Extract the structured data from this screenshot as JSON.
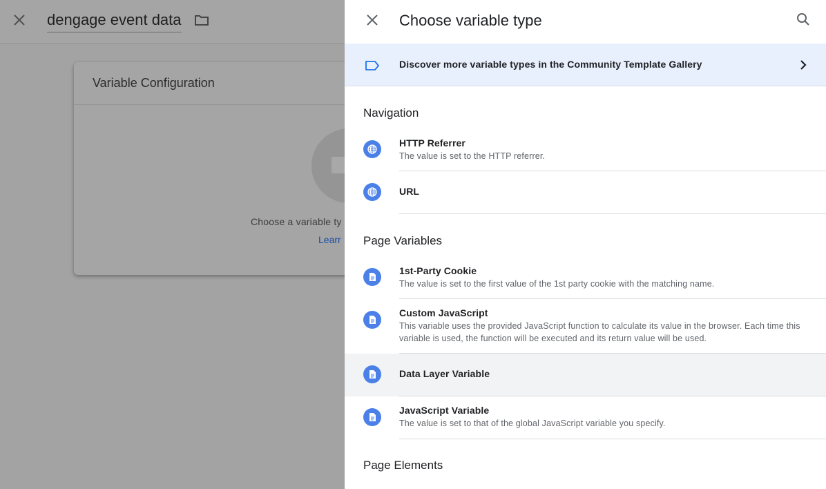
{
  "background": {
    "title": "dengage event data",
    "card": {
      "title": "Variable Configuration",
      "prompt_text": "Choose a variable ty",
      "link_text": "Learr"
    }
  },
  "panel": {
    "title": "Choose variable type",
    "banner_text": "Discover more variable types in the Community Template Gallery",
    "sections": [
      {
        "label": "Navigation",
        "items": [
          {
            "title": "HTTP Referrer",
            "desc": "The value is set to the HTTP referrer.",
            "icon": "globe-icon"
          },
          {
            "title": "URL",
            "desc": "",
            "icon": "globe-icon"
          }
        ]
      },
      {
        "label": "Page Variables",
        "items": [
          {
            "title": "1st-Party Cookie",
            "desc": "The value is set to the first value of the 1st party cookie with the matching name.",
            "icon": "document-icon"
          },
          {
            "title": "Custom JavaScript",
            "desc": "This variable uses the provided JavaScript function to calculate its value in the browser. Each time this variable is used, the function will be executed and its return value will be used.",
            "icon": "document-icon"
          },
          {
            "title": "Data Layer Variable",
            "desc": "",
            "icon": "document-icon",
            "highlighted": true
          },
          {
            "title": "JavaScript Variable",
            "desc": "The value is set to that of the global JavaScript variable you specify.",
            "icon": "document-icon"
          }
        ]
      },
      {
        "label": "Page Elements",
        "items": []
      }
    ]
  },
  "colors": {
    "accent": "#4a80e8",
    "banner_bg": "#e8f0fe",
    "highlight_bg": "#f1f3f4",
    "overlay_bg": "#a3a3a3"
  }
}
